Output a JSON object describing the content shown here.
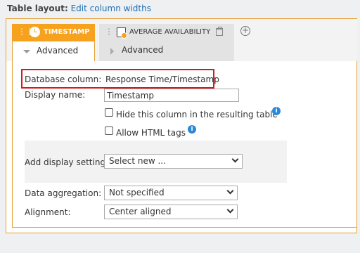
{
  "header": {
    "title": "Table layout:",
    "link": "Edit column widths"
  },
  "tabs": [
    {
      "label": "TIMESTAMP",
      "advanced": "Advanced",
      "icon": "clock-icon"
    },
    {
      "label": "AVERAGE AVAILABILITY",
      "advanced": "Advanced",
      "icon": "calculator-icon"
    }
  ],
  "form": {
    "db_column_label": "Database column:",
    "db_column_value": "Response Time/Timestamp",
    "display_name_label": "Display name:",
    "display_name_value": "Timestamp",
    "hide_column_label": "Hide this column in the resulting table",
    "allow_html_label": "Allow HTML tags",
    "add_display_label": "Add display settings:",
    "add_display_value": "Select new ...",
    "aggregation_label": "Data aggregation:",
    "aggregation_value": "Not specified",
    "alignment_label": "Alignment:",
    "alignment_value": "Center aligned"
  },
  "colors": {
    "accent": "#f7a21e",
    "highlight": "#d6191f",
    "link": "#1f6fb2",
    "info": "#2a88d8"
  }
}
